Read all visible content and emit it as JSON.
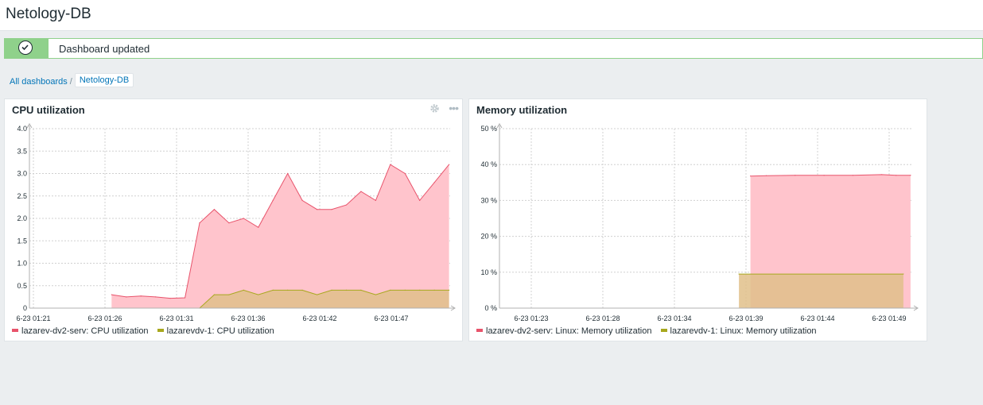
{
  "header": {
    "title": "Netology-DB"
  },
  "message": {
    "text": "Dashboard updated"
  },
  "breadcrumb": {
    "all_label": "All dashboards",
    "separator": "/",
    "current_label": "Netology-DB"
  },
  "colors": {
    "series1": "#e8536b",
    "series1_fill": "#ffc4cc",
    "series2": "#a8a81e",
    "series2_fill": "#e0c08a",
    "accent": "#0275b8"
  },
  "widgets": [
    {
      "title": "CPU utilization",
      "icons": [
        "gear-icon",
        "more-icon"
      ],
      "legend": [
        "lazarev-dv2-serv: CPU utilization",
        "lazarevdv-1: CPU utilization"
      ]
    },
    {
      "title": "Memory utilization",
      "legend": [
        "lazarev-dv2-serv: Linux: Memory utilization",
        "lazarevdv-1: Linux: Memory utilization"
      ]
    }
  ],
  "chart_data": [
    {
      "type": "area",
      "title": "CPU utilization",
      "xlabel": "",
      "ylabel": "",
      "x_ticks": [
        "6-23 01:21",
        "6-23 01:26",
        "6-23 01:31",
        "6-23 01:36",
        "6-23 01:42",
        "6-23 01:47"
      ],
      "y_ticks": [
        "0",
        "0.5",
        "1.0",
        "1.5",
        "2.0",
        "2.5",
        "3.0",
        "3.5",
        "4.0"
      ],
      "ylim": [
        0,
        4.0
      ],
      "x_range_minutes": [
        0,
        29
      ],
      "grid": true,
      "legend_position": "bottom",
      "series": [
        {
          "name": "lazarev-dv2-serv: CPU utilization",
          "x": [
            5.6,
            6.6,
            7.6,
            8.6,
            9.6,
            10.6,
            11.6,
            12.6,
            13.6,
            14.6,
            15.6,
            16.6,
            17.6,
            18.6,
            19.6,
            20.6,
            21.6,
            22.6,
            23.6,
            24.6,
            25.6,
            26.6,
            27.6,
            28.6
          ],
          "values": [
            0.3,
            0.25,
            0.27,
            0.25,
            0.22,
            0.23,
            1.9,
            2.2,
            1.9,
            2.0,
            1.8,
            2.4,
            3.0,
            2.4,
            2.2,
            2.2,
            2.3,
            2.6,
            2.4,
            3.2,
            3.0,
            2.4,
            2.8,
            3.2
          ]
        },
        {
          "name": "lazarevdv-1: CPU utilization",
          "x": [
            11.6,
            12.6,
            13.6,
            14.6,
            15.6,
            16.6,
            17.6,
            18.6,
            19.6,
            20.6,
            21.6,
            22.6,
            23.6,
            24.6,
            25.6,
            26.6,
            27.6,
            28.6
          ],
          "values": [
            0.0,
            0.3,
            0.3,
            0.4,
            0.3,
            0.4,
            0.4,
            0.4,
            0.3,
            0.4,
            0.4,
            0.4,
            0.3,
            0.4,
            0.4,
            0.4,
            0.4,
            0.4
          ]
        }
      ]
    },
    {
      "type": "area",
      "title": "Memory utilization",
      "xlabel": "",
      "ylabel": "",
      "x_ticks": [
        "6-23 01:23",
        "6-23 01:28",
        "6-23 01:34",
        "6-23 01:39",
        "6-23 01:44",
        "6-23 01:49"
      ],
      "y_ticks": [
        "0 %",
        "10 %",
        "20 %",
        "30 %",
        "40 %",
        "50 %"
      ],
      "ylim": [
        0,
        50
      ],
      "x_range_minutes": [
        0,
        29
      ],
      "grid": true,
      "legend_position": "bottom",
      "series": [
        {
          "name": "lazarev-dv2-serv: Linux: Memory utilization",
          "x": [
            17.4,
            18.5,
            20.5,
            22.5,
            24.5,
            26.5,
            27.5,
            28.5
          ],
          "values": [
            36.8,
            36.9,
            37.0,
            37.0,
            37.0,
            37.2,
            37.0,
            37.0
          ]
        },
        {
          "name": "lazarevdv-1: Linux: Memory utilization",
          "x": [
            16.6,
            28.0
          ],
          "values": [
            9.5,
            9.5
          ]
        }
      ]
    }
  ]
}
